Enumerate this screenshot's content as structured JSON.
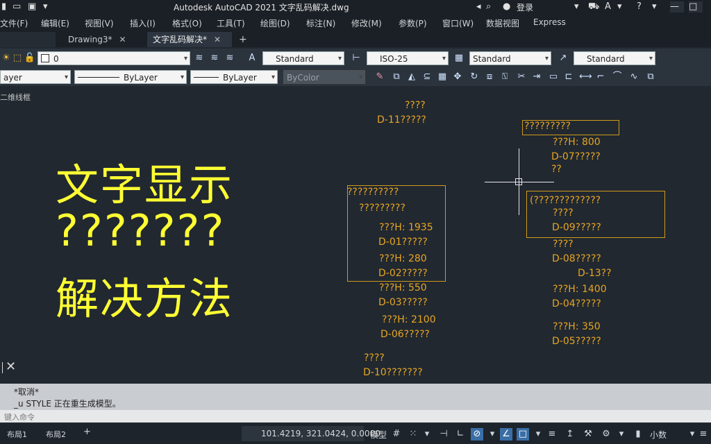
{
  "titlebar": {
    "title": "Autodesk AutoCAD 2021    文字乱码解决.dwg",
    "sign_in": "登录",
    "icons": [
      "save-icon",
      "open-icon",
      "search-icon",
      "user-icon",
      "cart-icon",
      "help-icon",
      "minimize-icon"
    ]
  },
  "menu": [
    "文件(F)",
    "编辑(E)",
    "视图(V)",
    "插入(I)",
    "格式(O)",
    "工具(T)",
    "绘图(D)",
    "标注(N)",
    "修改(M)",
    "参数(P)",
    "窗口(W)",
    "数据视图",
    "Express"
  ],
  "tabs": {
    "t1": "Drawing3*",
    "t2": "文字乱码解决*",
    "close": "✕",
    "add": "+"
  },
  "ribbon": {
    "layer_value": "0",
    "text_style": "Standard",
    "dim_style": "ISO-25",
    "table_style": "Standard",
    "mleader_style": "Standard",
    "layer_short": "ayer",
    "linetype": "ByLayer",
    "lineweight": "ByLayer",
    "plotstyle": "ByColor"
  },
  "drawing": {
    "view_label": "二维线框",
    "big1": "文字显示",
    "big2": "???????",
    "big3": "解决方法",
    "texts": [
      "????",
      "D-11?????",
      "??????????",
      "?????????",
      "???H: 1935",
      "D-01?????",
      "???H: 280",
      "D-02?????",
      "???H: 550",
      "D-03?????",
      "???H: 2100",
      "D-06?????",
      "????",
      "D-10???????",
      "?????????",
      "???H: 800",
      "D-07?????",
      "??",
      "(?????????????",
      "????",
      "D-09?????",
      "????",
      "D-08?????",
      "D-13??",
      "???H: 1400",
      "D-04?????",
      "???H: 350",
      "D-05?????"
    ]
  },
  "command": {
    "line1": "*取消*",
    "line2": "_u STYLE 正在重生成模型。",
    "prompt_placeholder": "键入命令"
  },
  "status": {
    "layout1": "布局1",
    "layout2": "布局2",
    "add": "+",
    "coords": "101.4219, 321.0424, 0.0000",
    "model": "模型",
    "units": "小数"
  }
}
